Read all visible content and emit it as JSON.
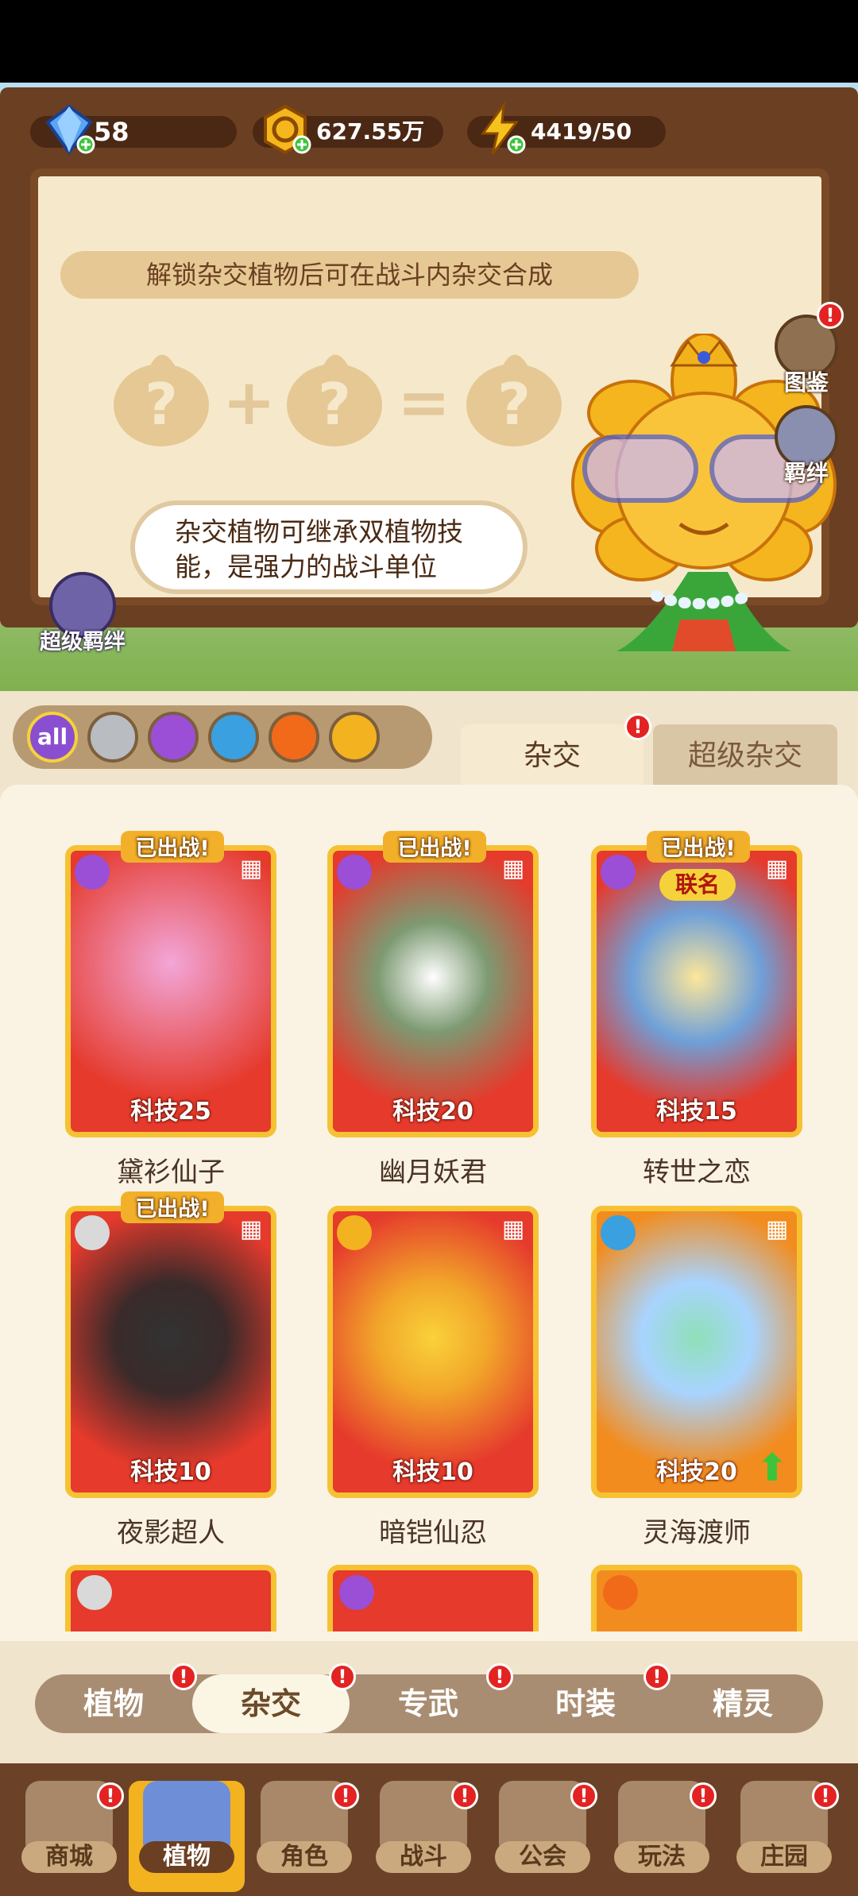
{
  "resources": {
    "gems": "58",
    "gold": "627.55万",
    "energy": "4419/50"
  },
  "hybrid_info": {
    "unlock_hint": "解锁杂交植物后可在战斗内杂交合成",
    "description": "杂交植物可继承双植物技能，是强力的战斗单位"
  },
  "side_buttons": {
    "handbook": "图鉴",
    "bond": "羁绊",
    "super_bond": "超级羁绊"
  },
  "filters": [
    {
      "name": "all",
      "label": "all",
      "color": "#8a4fd0"
    },
    {
      "name": "sword",
      "label": "",
      "color": "#9aa1a8"
    },
    {
      "name": "potion",
      "label": "",
      "color": "#9b4fd6"
    },
    {
      "name": "water",
      "label": "",
      "color": "#3aa0e0"
    },
    {
      "name": "fire",
      "label": "",
      "color": "#f06a1a"
    },
    {
      "name": "lightning",
      "label": "",
      "color": "#f3b21f"
    }
  ],
  "tabs": {
    "hybrid": "杂交",
    "super_hybrid": "超级杂交"
  },
  "cards": [
    {
      "name": "黛衫仙子",
      "tech": "科技25",
      "deployed": "已出战!",
      "element_color": "#9b4fd6",
      "frame": "#e53a2c"
    },
    {
      "name": "幽月妖君",
      "tech": "科技20",
      "deployed": "已出战!",
      "element_color": "#9b4fd6",
      "frame": "#e53a2c"
    },
    {
      "name": "转世之恋",
      "tech": "科技15",
      "deployed": "已出战!",
      "element_color": "#9b4fd6",
      "frame": "#e53a2c",
      "tag": "联名"
    },
    {
      "name": "夜影超人",
      "tech": "科技10",
      "deployed": "已出战!",
      "element_color": "#c9c9c9",
      "frame": "#e53a2c"
    },
    {
      "name": "暗铠仙忍",
      "tech": "科技10",
      "deployed": "",
      "element_color": "#f3b21f",
      "frame": "#e53a2c"
    },
    {
      "name": "灵海渡师",
      "tech": "科技20",
      "deployed": "",
      "element_color": "#3aa0e0",
      "frame": "#f28c1e"
    }
  ],
  "subnav": [
    "植物",
    "杂交",
    "专武",
    "时装",
    "精灵"
  ],
  "mainnav": [
    "商城",
    "植物",
    "角色",
    "战斗",
    "公会",
    "玩法",
    "庄园"
  ],
  "badge": "!"
}
